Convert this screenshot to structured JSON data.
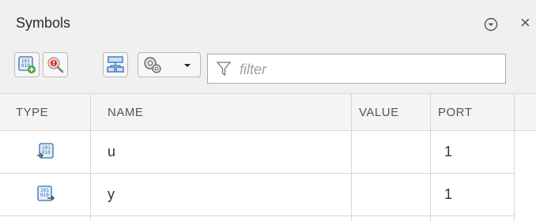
{
  "panel": {
    "title": "Symbols"
  },
  "toolbar": {
    "filter_placeholder": "filter"
  },
  "table": {
    "columns": [
      "TYPE",
      "NAME",
      "VALUE",
      "PORT"
    ],
    "rows": [
      {
        "type_icon": "input-port-icon",
        "name": "u",
        "value": "",
        "port": "1"
      },
      {
        "type_icon": "output-port-icon",
        "name": "y",
        "value": "",
        "port": "1"
      }
    ]
  },
  "colors": {
    "panel_bg": "#f0f0f0",
    "header_bg": "#f4f4f4",
    "accent_blue": "#2a6ebb",
    "accent_green": "#3aa53a",
    "accent_red": "#d9342b"
  }
}
